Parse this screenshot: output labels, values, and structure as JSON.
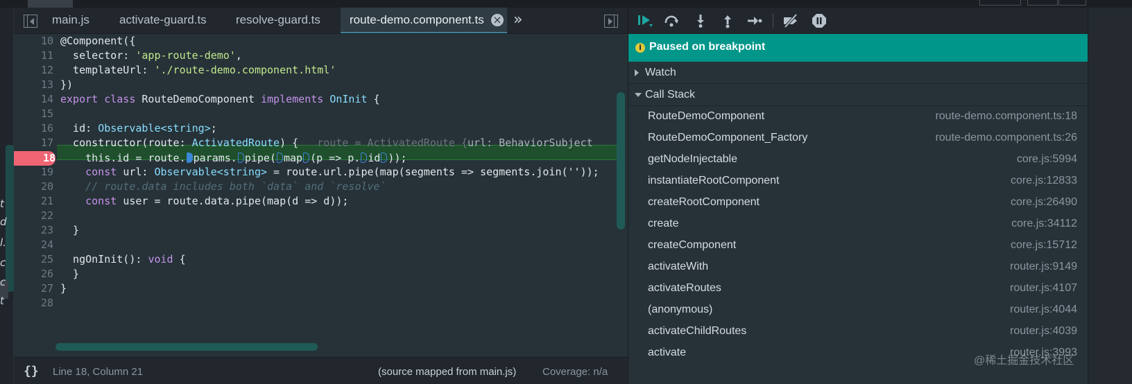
{
  "left_clip": {
    "chars": [
      "t",
      "d",
      "l.",
      "c",
      "c",
      "t"
    ]
  },
  "tabs": [
    {
      "label": "main.js"
    },
    {
      "label": "activate-guard.ts"
    },
    {
      "label": "resolve-guard.ts"
    },
    {
      "label": "route-demo.component.ts",
      "active": true,
      "close": "×"
    }
  ],
  "more_tabs": "»",
  "editor": {
    "line_numbers": [
      "10",
      "11",
      "12",
      "13",
      "14",
      "15",
      "16",
      "17",
      "18",
      "19",
      "20",
      "21",
      "22",
      "23",
      "24",
      "25",
      "26",
      "27",
      "28"
    ],
    "breakpoint_line": "18",
    "code": {
      "l10": "@Component({",
      "l11_a": "  selector: ",
      "l11_b": "'app-route-demo'",
      "l11_c": ",",
      "l12_a": "  templateUrl: ",
      "l12_b": "'./route-demo.component.html'",
      "l13": "})",
      "l14_a": "export ",
      "l14_b": "class ",
      "l14_c": "RouteDemoComponent ",
      "l14_d": "implements ",
      "l14_e": "OnInit",
      "l14_f": " {",
      "l16_a": "  id: ",
      "l16_b": "Observable<string>",
      "l16_c": ";",
      "l17_a": "  constructor(route: ",
      "l17_b": "ActivatedRoute",
      "l17_c": ") {",
      "l17_hint_a": "route = ActivatedRoute {",
      "l17_hint_b": "url: BehaviorSubject",
      "l18_a": "    this.id = route.",
      "l18_b": "params.",
      "l18_c": "pipe(",
      "l18_d": "map",
      "l18_e": "(p => p.",
      "l18_f": "id",
      "l18_g": "));",
      "l19_a": "    const ",
      "l19_b": "url: ",
      "l19_c": "Observable<string>",
      "l19_d": " = route.url.pipe(map(segments => segments.join(''));",
      "l20": "    // route.data includes both `data` and `resolve`",
      "l21_a": "    const ",
      "l21_b": "user = route.data.pipe(map(d => d));",
      "l23": "  }",
      "l25_a": "  ngOnInit(): ",
      "l25_b": "void",
      "l25_c": " {",
      "l26": "  }",
      "l27": "}"
    }
  },
  "status": {
    "braces": "{}",
    "position": "Line 18, Column 21",
    "source_map": "(source mapped from main.js)",
    "coverage": "Coverage: n/a"
  },
  "debugger": {
    "paused_icon": "i",
    "paused_text": "Paused on breakpoint",
    "watch_label": "Watch",
    "call_stack_label": "Call Stack",
    "frames": [
      {
        "fn": "RouteDemoComponent",
        "loc": "route-demo.component.ts:18"
      },
      {
        "fn": "RouteDemoComponent_Factory",
        "loc": "route-demo.component.ts:26"
      },
      {
        "fn": "getNodeInjectable",
        "loc": "core.js:5994"
      },
      {
        "fn": "instantiateRootComponent",
        "loc": "core.js:12833"
      },
      {
        "fn": "createRootComponent",
        "loc": "core.js:26490"
      },
      {
        "fn": "create",
        "loc": "core.js:34112"
      },
      {
        "fn": "createComponent",
        "loc": "core.js:15712"
      },
      {
        "fn": "activateWith",
        "loc": "router.js:9149"
      },
      {
        "fn": "activateRoutes",
        "loc": "router.js:4107"
      },
      {
        "fn": "(anonymous)",
        "loc": "router.js:4044"
      },
      {
        "fn": "activateChildRoutes",
        "loc": "router.js:4039"
      },
      {
        "fn": "activate",
        "loc": "router.js:3993"
      }
    ]
  },
  "watermark": "@稀土掘金技术社区",
  "colors": {
    "paused_banner": "#00968a",
    "breakpoint": "#f06574",
    "exec_line": "#1f4f2c"
  }
}
